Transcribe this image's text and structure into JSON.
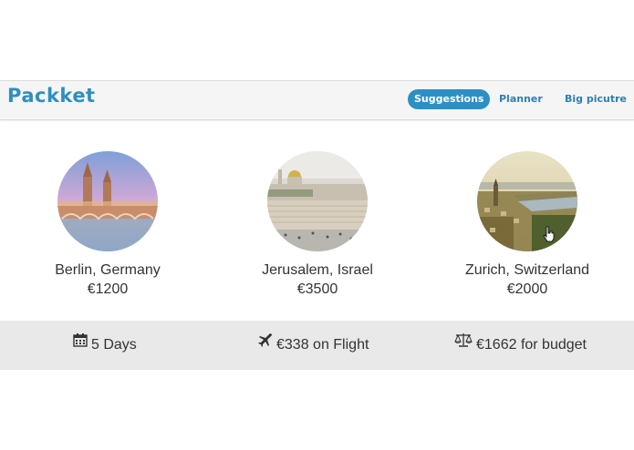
{
  "header": {
    "brand": "Packket",
    "nav": [
      {
        "label": "Suggestions",
        "active": true
      },
      {
        "label": "Planner",
        "active": false
      },
      {
        "label": "Big picutre",
        "active": false
      }
    ]
  },
  "destinations": [
    {
      "city": "Berlin, Germany",
      "price": "€1200",
      "image_icon": "berlin-photo"
    },
    {
      "city": "Jerusalem, Israel",
      "price": "€3500",
      "image_icon": "jerusalem-photo"
    },
    {
      "city": "Zurich, Switzerland",
      "price": "€2000",
      "image_icon": "zurich-photo"
    }
  ],
  "summary": {
    "days": {
      "icon": "calendar-icon",
      "text": "5 Days"
    },
    "flight": {
      "icon": "plane-icon",
      "text": "€338 on Flight"
    },
    "budget": {
      "icon": "balance-scale-icon",
      "text": "€1662 for budget"
    }
  },
  "colors": {
    "accent": "#2c90c4",
    "brand": "#2f8fbf"
  }
}
